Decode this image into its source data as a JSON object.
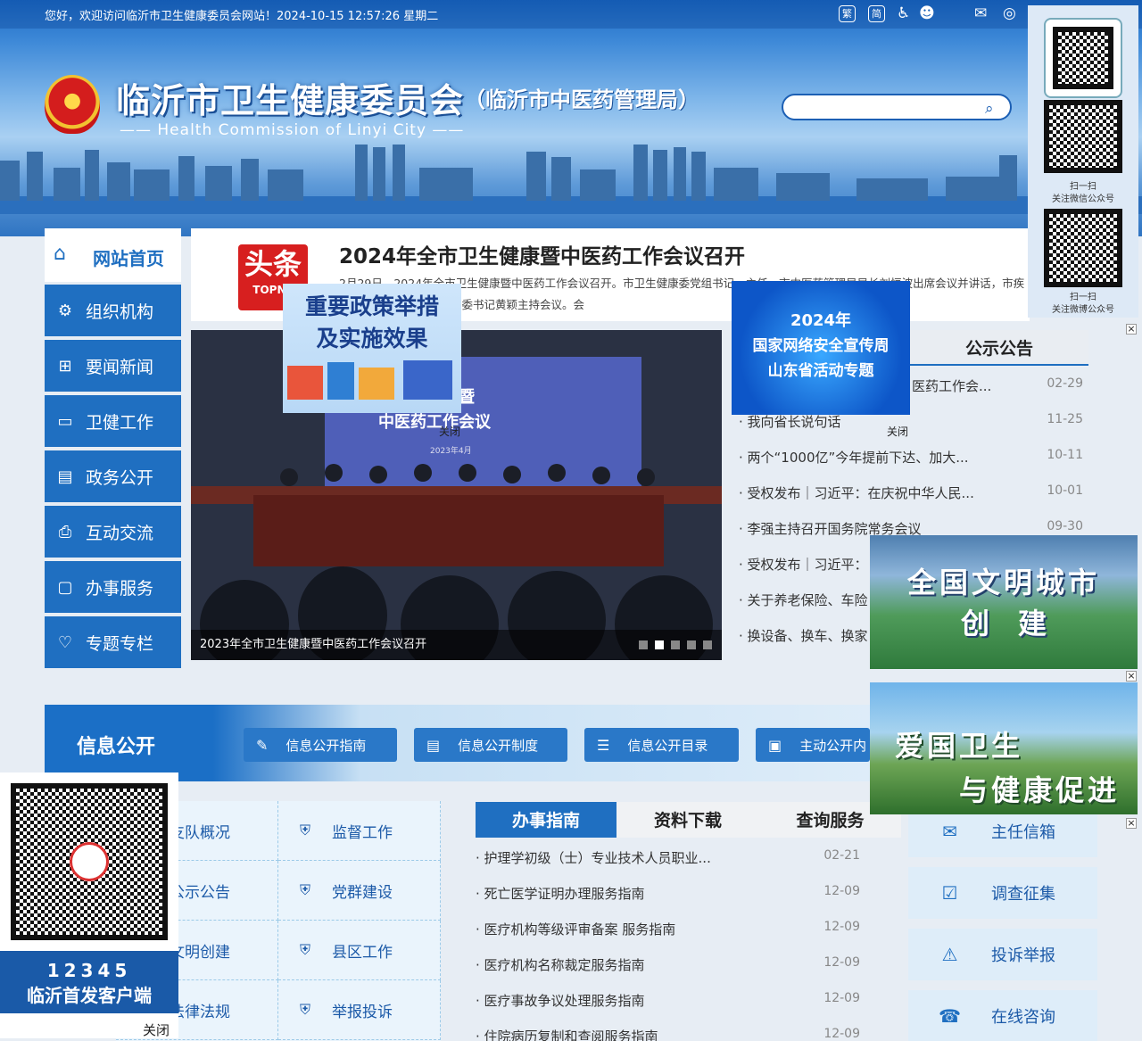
{
  "header": {
    "welcome": "您好，欢迎访问临沂市卫生健康委员会网站！2024-10-15 12:57:26 星期二",
    "tools": [
      "繁",
      "简"
    ],
    "title": "临沂市卫生健康委员会",
    "subtitle": "（临沂市中医药管理局）",
    "english": "—— Health Commission of Linyi City ——",
    "search_placeholder": ""
  },
  "nav": {
    "home": "网站首页",
    "items": [
      "组织机构",
      "要闻新闻",
      "卫健工作",
      "政务公开",
      "互动交流",
      "办事服务",
      "专题专栏"
    ]
  },
  "headline": {
    "badge_top": "头条",
    "badge_bottom": "TOPNE",
    "title": "2024年全市卫生健康暨中医药工作会议召开",
    "desc": "2月29日，2024年全市卫生健康暨中医药工作会议召开。市卫生健康委党组书记、主任，市中医药管理局局长刘恒波出席会议并讲话，市疾控局局长、市疾控中心党委书记黄颖主持会议。会"
  },
  "slider": {
    "caption": "2023年全市卫生健康暨中医药工作会议召开",
    "screen_text": "卫生健康暨\n中医药工作会议",
    "screen_date": "2023年4月"
  },
  "notice": {
    "title": "公示公告",
    "items": [
      {
        "text": "医药工作会...",
        "date": "02-29"
      },
      {
        "text": "· 我向省长说句话",
        "date": "11-25"
      },
      {
        "text": "· 两个“1000亿”今年提前下达、加大...",
        "date": "10-11"
      },
      {
        "text": "· 受权发布｜习近平：在庆祝中华人民...",
        "date": "10-01"
      },
      {
        "text": "· 李强主持召开国务院常务会议",
        "date": "09-30"
      },
      {
        "text": "· 受权发布｜习近平：",
        "date": ""
      },
      {
        "text": "· 关于养老保险、车险",
        "date": ""
      },
      {
        "text": "· 换设备、换车、换家",
        "date": ""
      }
    ]
  },
  "floaters": {
    "policy_line1": "重要政策举措",
    "policy_line2": "及实施效果",
    "policy_close": "关闭",
    "cyber_line1": "2024年",
    "cyber_line2": "国家网络安全宣传周",
    "cyber_line3": "山东省活动专题",
    "cyber_close": "关闭",
    "civ_line1": "全国文明城市",
    "civ_line2": "创　建",
    "health_line1": "爱国卫生",
    "health_line2": "与健康促进",
    "x_mark": "×"
  },
  "qr_right": {
    "wechat_line1": "扫一扫",
    "wechat_line2": "关注微信公众号",
    "weibo_line1": "扫一扫",
    "weibo_line2": "关注微博公众号"
  },
  "qr_left": {
    "number": "12345",
    "label": "临沂首发客户端",
    "close": "关闭"
  },
  "info": {
    "title": "信息公开",
    "buttons": [
      "信息公开指南",
      "信息公开制度",
      "信息公开目录",
      "主动公开内"
    ]
  },
  "grid": {
    "left": [
      "支队概况",
      "公示公告",
      "文明创建",
      "法律法规"
    ],
    "right": [
      "监督工作",
      "党群建设",
      "县区工作",
      "举报投诉"
    ]
  },
  "service": {
    "tabs": [
      "办事指南",
      "资料下载",
      "查询服务"
    ],
    "items": [
      {
        "text": "· 护理学初级（士）专业技术人员职业...",
        "date": "02-21"
      },
      {
        "text": "· 死亡医学证明办理服务指南",
        "date": "12-09"
      },
      {
        "text": "· 医疗机构等级评审备案 服务指南",
        "date": "12-09"
      },
      {
        "text": "· 医疗机构名称裁定服务指南",
        "date": "12-09"
      },
      {
        "text": "· 医疗事故争议处理服务指南",
        "date": "12-09"
      },
      {
        "text": "· 住院病历复制和查阅服务指南",
        "date": "12-09"
      }
    ]
  },
  "quicklinks": [
    "主任信箱",
    "调查征集",
    "投诉举报",
    "在线咨询"
  ],
  "colors": {
    "primary": "#1f6fc1",
    "headline_red": "#d71f1f"
  }
}
